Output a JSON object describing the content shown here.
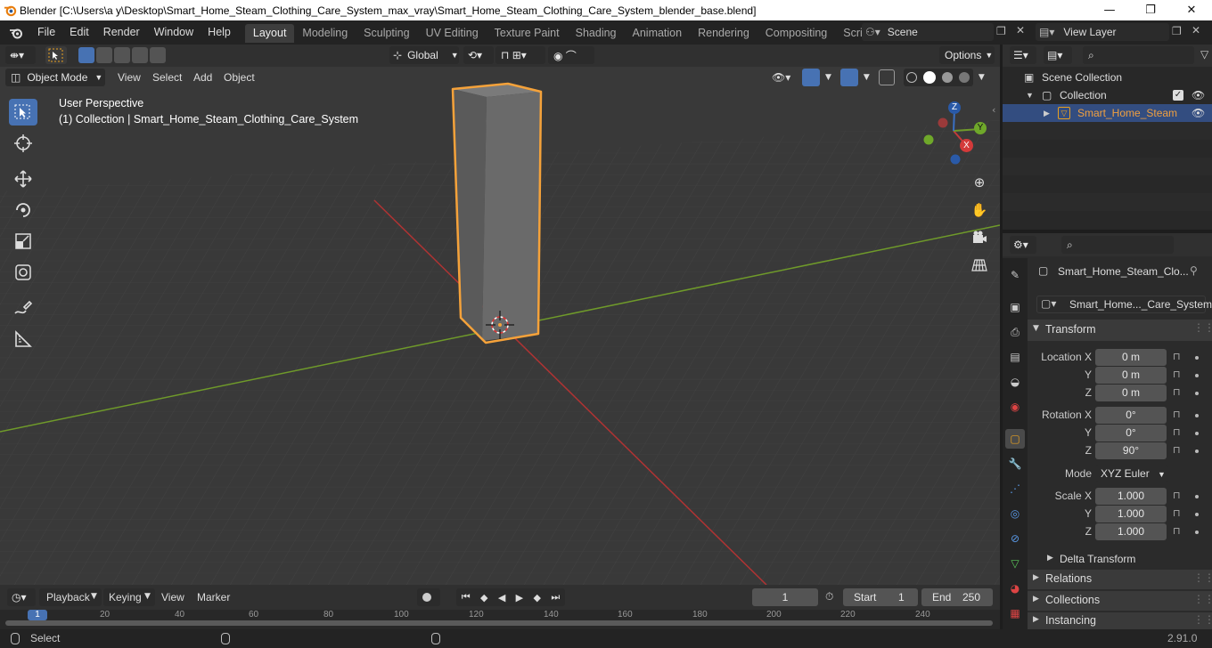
{
  "window": {
    "title": "Blender [C:\\Users\\a y\\Desktop\\Smart_Home_Steam_Clothing_Care_System_max_vray\\Smart_Home_Steam_Clothing_Care_System_blender_base.blend]",
    "minimize": "—",
    "maximize": "❐",
    "close": "✕"
  },
  "menus": [
    "File",
    "Edit",
    "Render",
    "Window",
    "Help"
  ],
  "workspaces": [
    "Layout",
    "Modeling",
    "Sculpting",
    "UV Editing",
    "Texture Paint",
    "Shading",
    "Animation",
    "Rendering",
    "Compositing",
    "Scripting"
  ],
  "active_workspace": "Layout",
  "scene": "Scene",
  "view_layer": "View Layer",
  "toolbar": {
    "transform_orientation": "Global",
    "options": "Options"
  },
  "viewport_header": {
    "mode": "Object Mode",
    "menus": [
      "View",
      "Select",
      "Add",
      "Object"
    ]
  },
  "viewport": {
    "perspective": "User Perspective",
    "collection_info": "(1) Collection | Smart_Home_Steam_Clothing_Care_System",
    "gizmo": {
      "x": "X",
      "y": "Y",
      "z": "Z"
    }
  },
  "outliner": {
    "scene_collection": "Scene Collection",
    "collection": "Collection",
    "object": "Smart_Home_Steam"
  },
  "properties": {
    "object_name": "Smart_Home_Steam_Clo...",
    "data_name": "Smart_Home..._Care_System",
    "transform_title": "Transform",
    "location_label": "Location X",
    "rotation_label": "Rotation X",
    "scale_label": "Scale X",
    "y_label": "Y",
    "z_label": "Z",
    "location": {
      "x": "0 m",
      "y": "0 m",
      "z": "0 m"
    },
    "rotation": {
      "x": "0°",
      "y": "0°",
      "z": "90°"
    },
    "mode_label": "Mode",
    "rotation_mode": "XYZ Euler",
    "scale": {
      "x": "1.000",
      "y": "1.000",
      "z": "1.000"
    },
    "delta_transform": "Delta Transform",
    "relations": "Relations",
    "collections": "Collections",
    "instancing": "Instancing"
  },
  "timeline": {
    "menus": [
      "Playback",
      "Keying",
      "View",
      "Marker"
    ],
    "current_frame": "1",
    "start_label": "Start",
    "start": "1",
    "end_label": "End",
    "end": "250",
    "ruler": [
      "1",
      "20",
      "40",
      "60",
      "80",
      "100",
      "120",
      "140",
      "160",
      "180",
      "200",
      "220",
      "240"
    ]
  },
  "status": {
    "left": "Select",
    "version": "2.91.0"
  },
  "colors": {
    "accent": "#4772b3",
    "selection_outline": "#f5a23a",
    "x_axis": "#c23a3a",
    "y_axis": "#6f9a2a"
  }
}
